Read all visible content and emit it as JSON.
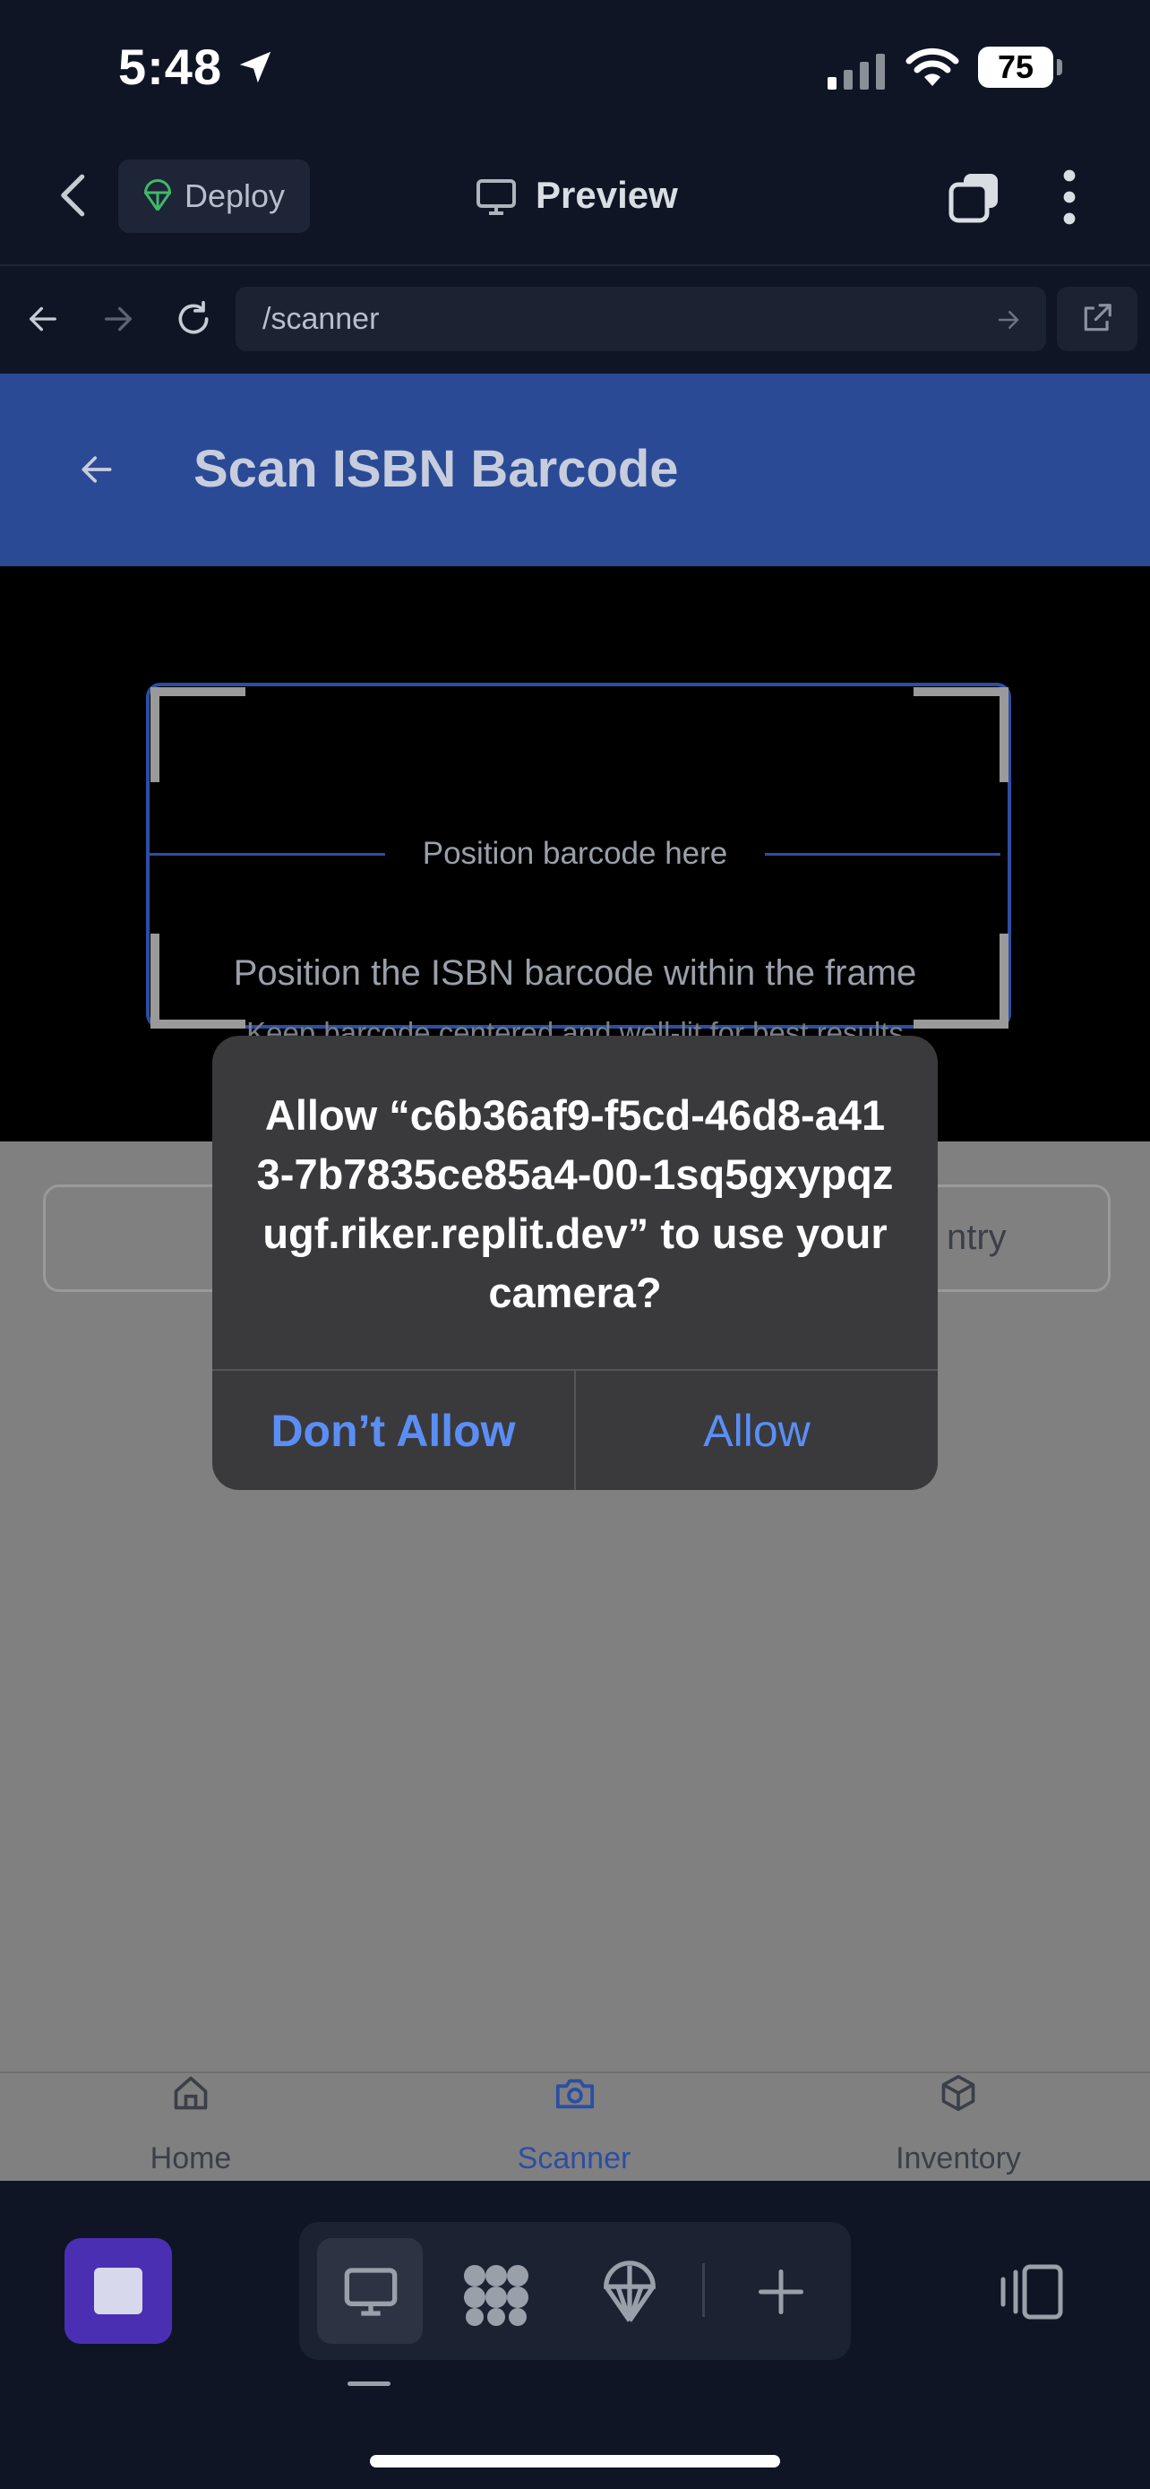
{
  "status_bar": {
    "time": "5:48",
    "battery": "75"
  },
  "top_bar": {
    "deploy_label": "Deploy",
    "preview_label": "Preview"
  },
  "url_bar": {
    "path": "/scanner"
  },
  "app": {
    "header_title": "Scan ISBN Barcode",
    "scanner": {
      "frame_label": "Position barcode here",
      "instruction": "Position the ISBN barcode within the frame",
      "hint": "Keep barcode centered and well-lit for best results"
    },
    "action_partial_label": "ntry",
    "tabs": [
      {
        "label": "Home",
        "icon": "home-icon"
      },
      {
        "label": "Scanner",
        "icon": "camera-icon"
      },
      {
        "label": "Inventory",
        "icon": "box-icon"
      }
    ]
  },
  "dialog": {
    "message": "Allow “c6b36af9-f5cd-46d8-a413-7b7835ce85a4-00-1sq5gxypqzugf.riker.replit.dev” to use your camera?",
    "deny_label": "Don’t Allow",
    "allow_label": "Allow"
  },
  "colors": {
    "accent": "#2b4a96",
    "dialog_button": "#5b8ef5",
    "active_tab": "#2c4ea3"
  }
}
